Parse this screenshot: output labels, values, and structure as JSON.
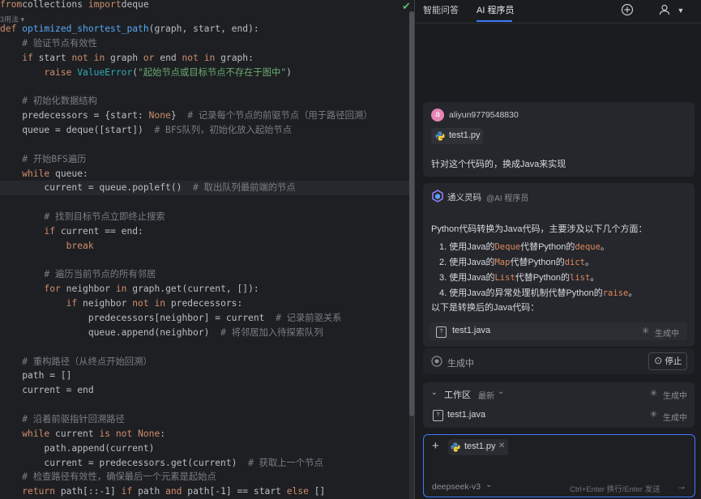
{
  "editor": {
    "lines": [
      [
        [
          "kw",
          "from"
        ],
        [
          "",
          "collections "
        ],
        [
          "kw",
          "import"
        ],
        [
          "",
          "deque"
        ]
      ],
      [
        [
          "cm",
          "3用法 ▾"
        ]
      ],
      [
        [
          "kw",
          "def "
        ],
        [
          "fn",
          "optimized_shortest_path"
        ],
        [
          "",
          "(graph, start, end):"
        ]
      ],
      [
        [
          "",
          "    "
        ],
        [
          "cm",
          "# 验证节点有效性"
        ]
      ],
      [
        [
          "",
          "    "
        ],
        [
          "kw",
          "if "
        ],
        [
          "",
          "start "
        ],
        [
          "kw",
          "not in "
        ],
        [
          "",
          "graph "
        ],
        [
          "kw",
          "or "
        ],
        [
          "",
          "end "
        ],
        [
          "kw",
          "not in "
        ],
        [
          "",
          "graph:"
        ]
      ],
      [
        [
          "",
          "        "
        ],
        [
          "kw",
          "raise "
        ],
        [
          "cls",
          "ValueError"
        ],
        [
          "",
          "("
        ],
        [
          "str",
          "\"起始节点或目标节点不存在于图中\""
        ],
        [
          "",
          ")"
        ]
      ],
      [
        [
          "",
          ""
        ]
      ],
      [
        [
          "",
          "    "
        ],
        [
          "cm",
          "# 初始化数据结构"
        ]
      ],
      [
        [
          "",
          "    predecessors = {start: "
        ],
        [
          "none",
          "None"
        ],
        [
          "",
          "}  "
        ],
        [
          "cm",
          "# 记录每个节点的前驱节点（用于路径回溯）"
        ]
      ],
      [
        [
          "",
          "    queue = deque([start])  "
        ],
        [
          "cm",
          "# BFS队列，初始化放入起始节点"
        ]
      ],
      [
        [
          "",
          ""
        ]
      ],
      [
        [
          "",
          "    "
        ],
        [
          "cm",
          "# 开始BFS遍历"
        ]
      ],
      [
        [
          "",
          "    "
        ],
        [
          "kw",
          "while "
        ],
        [
          "",
          "queue:"
        ]
      ],
      [
        [
          "",
          "        current = queue.popleft()  "
        ],
        [
          "cm",
          "# 取出队列最前端的节点"
        ]
      ],
      [
        [
          "",
          ""
        ]
      ],
      [
        [
          "",
          "        "
        ],
        [
          "cm",
          "# 找到目标节点立即终止搜索"
        ]
      ],
      [
        [
          "",
          "        "
        ],
        [
          "kw",
          "if "
        ],
        [
          "",
          "current == end:"
        ]
      ],
      [
        [
          "",
          "            "
        ],
        [
          "kw",
          "break"
        ]
      ],
      [
        [
          "",
          ""
        ]
      ],
      [
        [
          "",
          "        "
        ],
        [
          "cm",
          "# 遍历当前节点的所有邻居"
        ]
      ],
      [
        [
          "",
          "        "
        ],
        [
          "kw",
          "for "
        ],
        [
          "",
          "neighbor "
        ],
        [
          "kw",
          "in "
        ],
        [
          "",
          "graph.get(current, []):"
        ]
      ],
      [
        [
          "",
          "            "
        ],
        [
          "kw",
          "if "
        ],
        [
          "",
          "neighbor "
        ],
        [
          "kw",
          "not in "
        ],
        [
          "",
          "predecessors:"
        ]
      ],
      [
        [
          "",
          "                predecessors[neighbor] = current  "
        ],
        [
          "cm",
          "# 记录前驱关系"
        ]
      ],
      [
        [
          "",
          "                queue.append(neighbor)  "
        ],
        [
          "cm",
          "# 将邻居加入待探索队列"
        ]
      ],
      [
        [
          "",
          ""
        ]
      ],
      [
        [
          "",
          "    "
        ],
        [
          "cm",
          "# 重构路径（从终点开始回溯）"
        ]
      ],
      [
        [
          "",
          "    path = []"
        ]
      ],
      [
        [
          "",
          "    current = end"
        ]
      ],
      [
        [
          "",
          ""
        ]
      ],
      [
        [
          "",
          "    "
        ],
        [
          "cm",
          "# 沿着前驱指针回溯路径"
        ]
      ],
      [
        [
          "",
          "    "
        ],
        [
          "kw",
          "while "
        ],
        [
          "",
          "current "
        ],
        [
          "kw",
          "is not "
        ],
        [
          "none",
          "None"
        ],
        [
          "",
          ":"
        ]
      ],
      [
        [
          "",
          "        path.append(current)"
        ]
      ],
      [
        [
          "",
          "        current = predecessors.get(current)  "
        ],
        [
          "cm",
          "# 获取上一个节点"
        ]
      ],
      [
        [
          "",
          "    "
        ],
        [
          "cm",
          "# 检查路径有效性，确保最后一个元素是起始点"
        ]
      ],
      [
        [
          "",
          "    "
        ],
        [
          "kw",
          "return "
        ],
        [
          "",
          "path[::-1] "
        ],
        [
          "kw",
          "if "
        ],
        [
          "",
          "path "
        ],
        [
          "kw",
          "and "
        ],
        [
          "",
          "path[-1] == start "
        ],
        [
          "kw",
          "else "
        ],
        [
          "",
          "[]"
        ]
      ]
    ]
  },
  "panel": {
    "tabs": [
      "智能问答",
      "AI 程序员"
    ],
    "user": {
      "avatar_letter": "a",
      "name": "aliyun9779548830",
      "file": "test1.py",
      "message": "针对这个代码的，换成Java来实现"
    },
    "assistant": {
      "name": "通义灵码",
      "role": "@AI 程序员",
      "intro": "Python代码转换为Java代码，主要涉及以下几个方面：",
      "items": [
        {
          "num": "1.",
          "a": "使用Java的",
          "c1": "Deque",
          "b": "代替Python的",
          "c2": "deque",
          "d": "。"
        },
        {
          "num": "2.",
          "a": "使用Java的",
          "c1": "Map",
          "b": "代替Python的",
          "c2": "dict",
          "d": "。"
        },
        {
          "num": "3.",
          "a": "使用Java的",
          "c1": "List",
          "b": "代替Python的",
          "c2": "list",
          "d": "。"
        },
        {
          "num": "4.",
          "a": "使用Java的异常处理机制代替Python的",
          "c1": "",
          "b": "",
          "c2": "raise",
          "d": "。"
        }
      ],
      "outro": "以下是转换后的Java代码：",
      "file": "test1.java",
      "file_status": "生成中"
    },
    "generating": {
      "label": "生成中",
      "stop_label": "停止"
    },
    "workspace": {
      "title": "工作区",
      "filter": "最新",
      "status": "生成中",
      "file": "test1.java",
      "file_status": "生成中"
    },
    "input": {
      "attach_file": "test1.py",
      "model": "deepseek-v3",
      "hint": "Ctrl+Enter 换行/Enter 发送"
    }
  }
}
